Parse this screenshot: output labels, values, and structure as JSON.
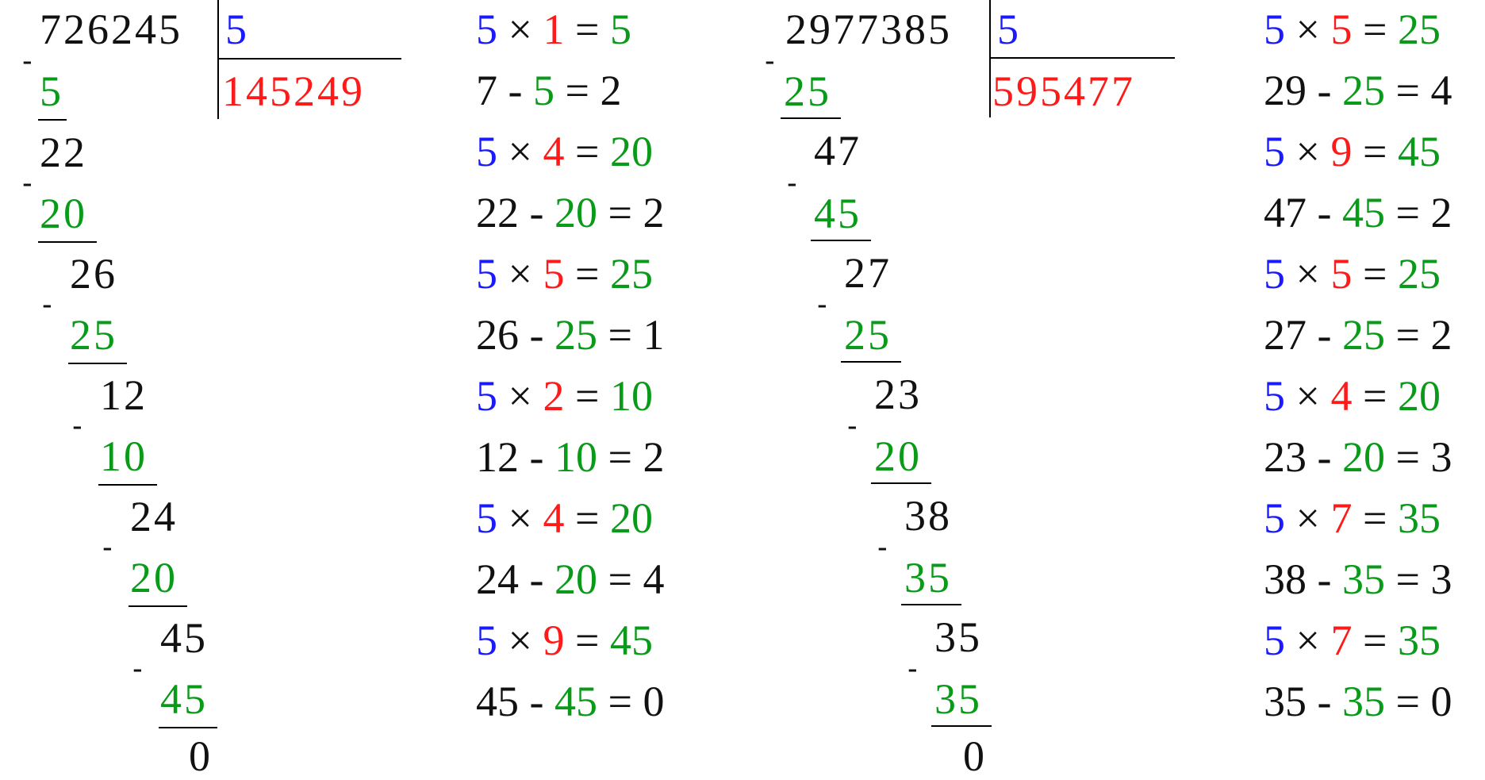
{
  "colors": {
    "divisor": "#1a1aff",
    "quotient_digit": "#ff1a1a",
    "product": "#0a9a1a",
    "text": "#111111"
  },
  "left": {
    "dividend": "726245",
    "divisor": "5",
    "quotient": "145249",
    "rows": [
      "5",
      "22",
      "20",
      "26",
      "25",
      "12",
      "10",
      "24",
      "20",
      "45",
      "45",
      "0"
    ],
    "minus": "-",
    "equations": [
      [
        "5",
        "×",
        "1",
        "=",
        "5"
      ],
      [
        "7",
        "-",
        "5",
        "=",
        "2"
      ],
      [
        "5",
        "×",
        "4",
        "=",
        "20"
      ],
      [
        "22",
        "-",
        "20",
        "=",
        "2"
      ],
      [
        "5",
        "×",
        "5",
        "=",
        "25"
      ],
      [
        "26",
        "-",
        "25",
        "=",
        "1"
      ],
      [
        "5",
        "×",
        "2",
        "=",
        "10"
      ],
      [
        "12",
        "-",
        "10",
        "=",
        "2"
      ],
      [
        "5",
        "×",
        "4",
        "=",
        "20"
      ],
      [
        "24",
        "-",
        "20",
        "=",
        "4"
      ],
      [
        "5",
        "×",
        "9",
        "=",
        "45"
      ],
      [
        "45",
        "-",
        "45",
        "=",
        "0"
      ]
    ]
  },
  "right": {
    "dividend": "2977385",
    "divisor": "5",
    "quotient": "595477",
    "rows": [
      "25",
      "47",
      "45",
      "27",
      "25",
      "23",
      "20",
      "38",
      "35",
      "35",
      "35",
      "0"
    ],
    "minus": "-",
    "equations": [
      [
        "5",
        "×",
        "5",
        "=",
        "25"
      ],
      [
        "29",
        "-",
        "25",
        "=",
        "4"
      ],
      [
        "5",
        "×",
        "9",
        "=",
        "45"
      ],
      [
        "47",
        "-",
        "45",
        "=",
        "2"
      ],
      [
        "5",
        "×",
        "5",
        "=",
        "25"
      ],
      [
        "27",
        "-",
        "25",
        "=",
        "2"
      ],
      [
        "5",
        "×",
        "4",
        "=",
        "20"
      ],
      [
        "23",
        "-",
        "20",
        "=",
        "3"
      ],
      [
        "5",
        "×",
        "7",
        "=",
        "35"
      ],
      [
        "38",
        "-",
        "35",
        "=",
        "3"
      ],
      [
        "5",
        "×",
        "7",
        "=",
        "35"
      ],
      [
        "35",
        "-",
        "35",
        "=",
        "0"
      ]
    ]
  }
}
